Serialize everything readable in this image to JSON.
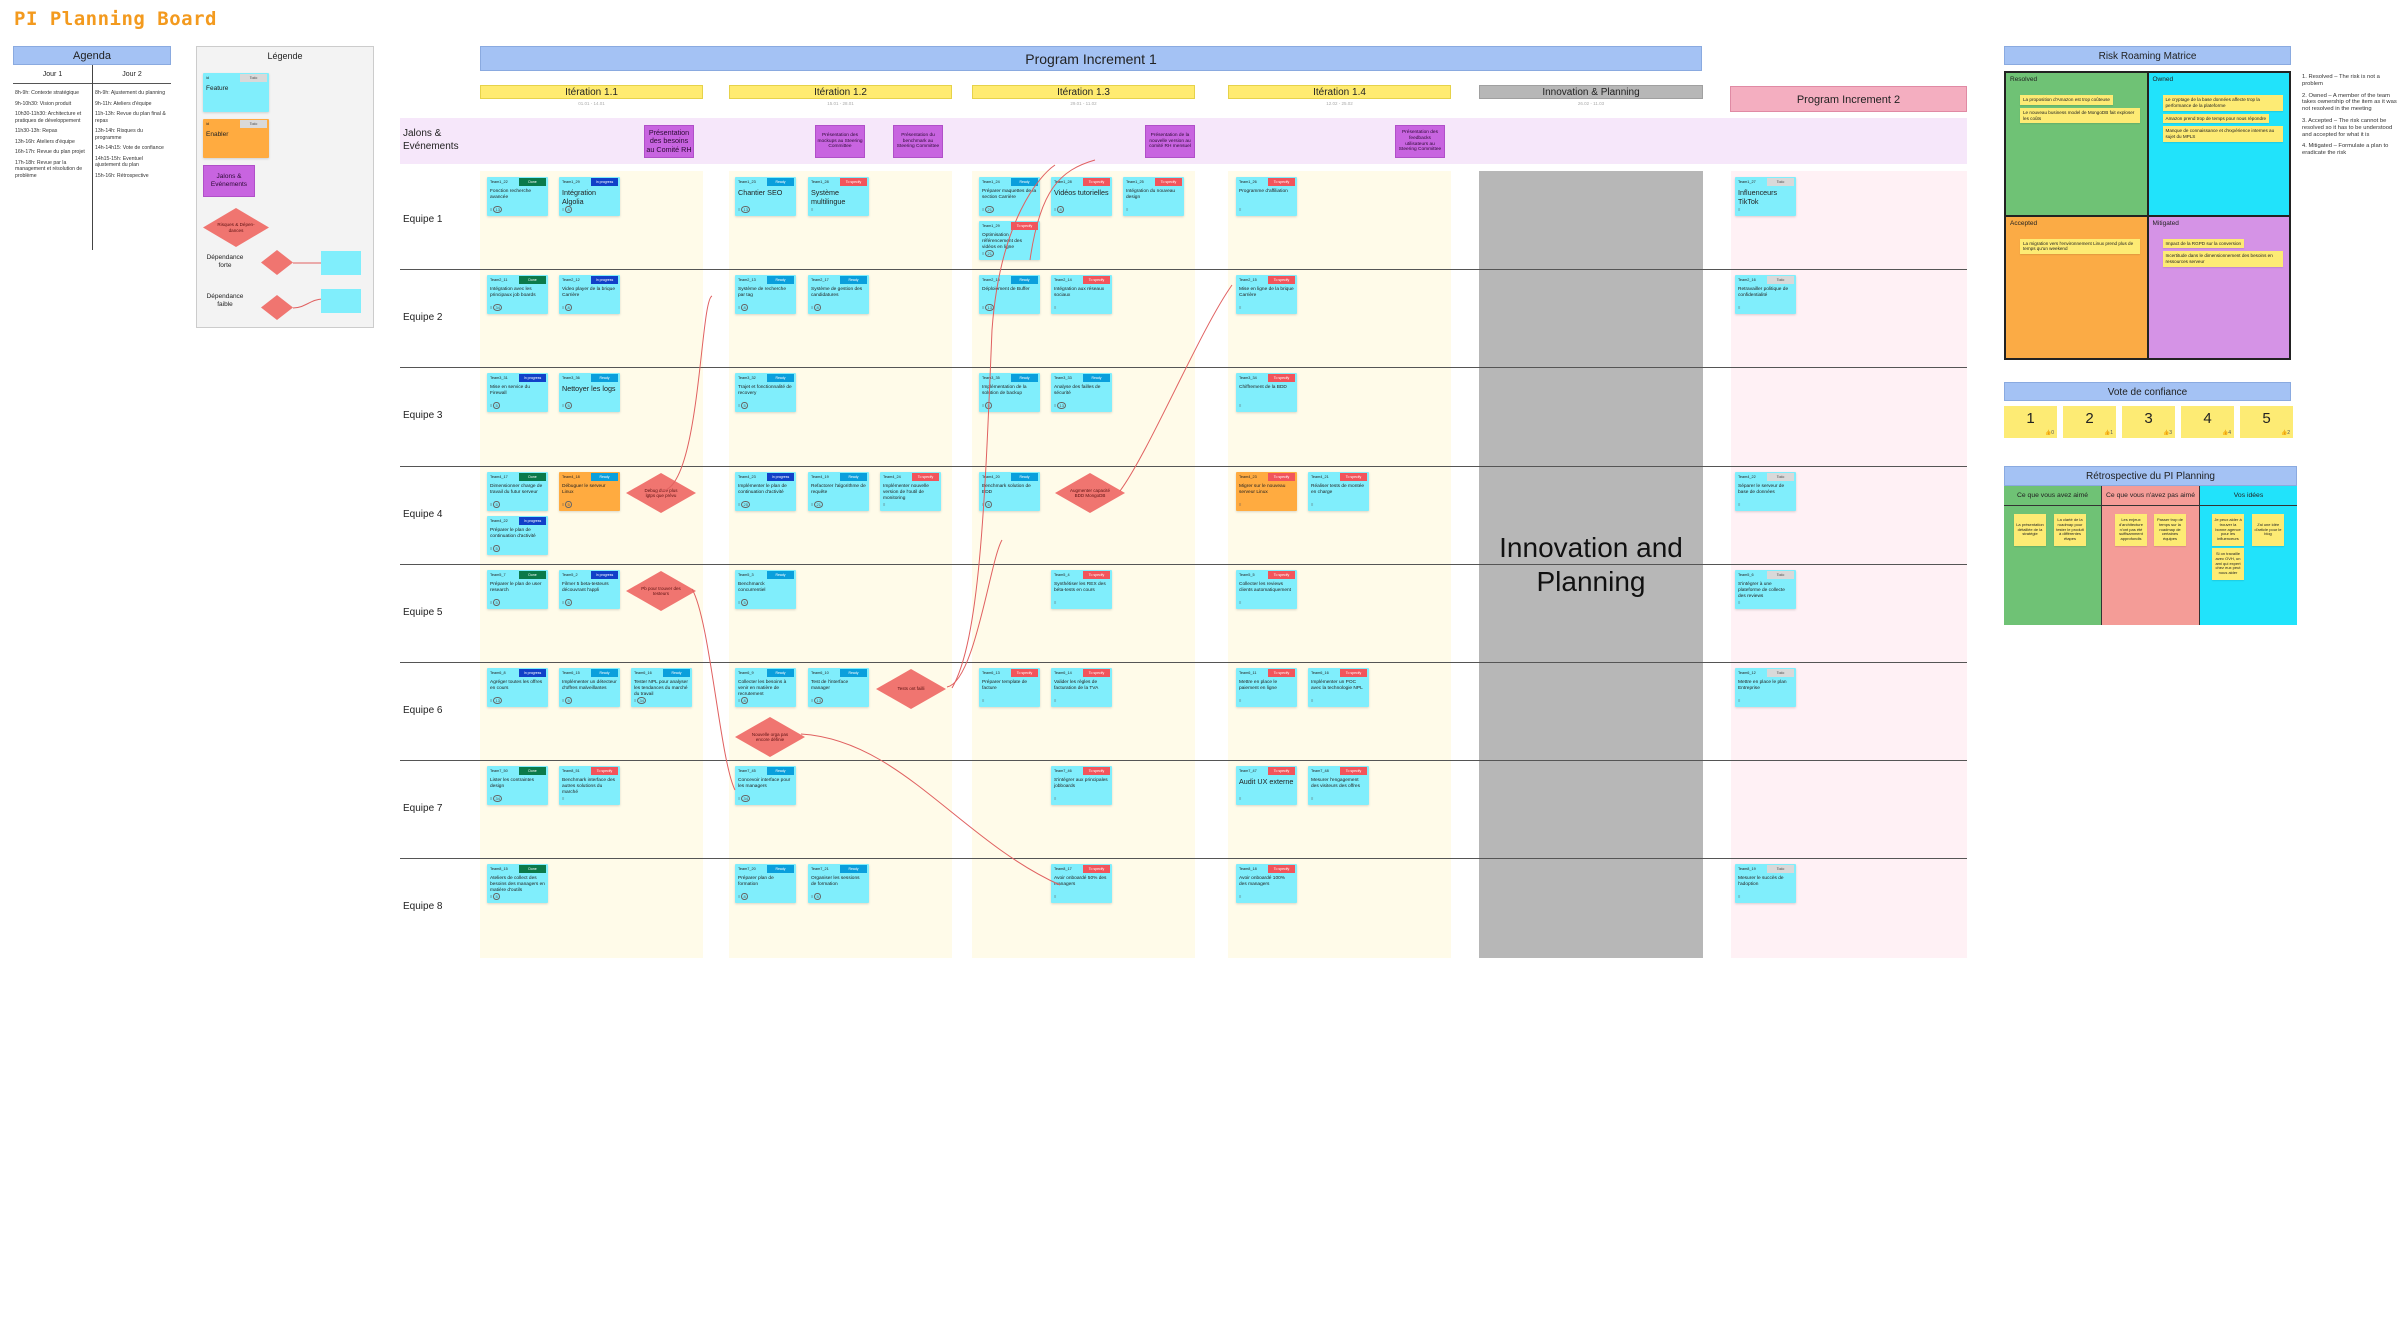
{
  "title": "PI Planning Board",
  "agenda": {
    "title": "Agenda",
    "days": [
      {
        "label": "Jour 1",
        "items": [
          "8h-9h: Contexte stratégique",
          "9h-10h30: Vision produit",
          "10h30-11h30: Architecture et pratiques de développement",
          "11h30-13h: Repas",
          "13h-16h: Ateliers d'équipe",
          "16h-17h: Revue du plan projet",
          "17h-18h: Revue par la management et résolution de problème"
        ]
      },
      {
        "label": "Jour 2",
        "items": [
          "8h-9h: Ajustement du planning",
          "9h-11h: Ateliers d'équipe",
          "11h-13h: Revue du plan final & repas",
          "13h-14h: Risques du programme",
          "14h-14h15: Vote de confiance",
          "14h15-15h: Eventuel ajustement du plan",
          "15h-16h: Rétrospective"
        ]
      }
    ]
  },
  "legend": {
    "title": "Légende",
    "feature": {
      "id": "id",
      "status": "Todo",
      "label": "Feature"
    },
    "enabler": {
      "id": "id",
      "status": "Todo",
      "label": "Enabler"
    },
    "milestone": "Jalons & Evénements",
    "risk": "Risques & Dépen-dances",
    "strong_dep": "Dépendance forte",
    "weak_dep": "Dépendance faible"
  },
  "board": {
    "pi1": "Program Increment 1",
    "pi2": "Program Increment 2",
    "iterations": [
      {
        "label": "Itération 1.1",
        "dates": "01.01 - 14.01"
      },
      {
        "label": "Itération 1.2",
        "dates": "15.01 - 28.01"
      },
      {
        "label": "Itération 1.3",
        "dates": "29.01 - 11.02"
      },
      {
        "label": "Itération 1.4",
        "dates": "12.02 - 25.02"
      },
      {
        "label": "Innovation & Planning",
        "dates": "26.02 - 11.03"
      }
    ],
    "innovation_block": "Innovation and Planning",
    "jalons_label": "Jalons & Evénements",
    "milestones": [
      "Présentation des besoins au Comité RH",
      "Présentation des mockups au Steering Committee",
      "Présentation du benchmark au Steering Committee",
      "Présentation de la nouvelle version au comité RH mensuel",
      "Présentation des feedbacks utilisateurs au Steering Committee"
    ],
    "lanes": [
      "Equipe 1",
      "Equipe 2",
      "Equipe 3",
      "Equipe 4",
      "Equipe 5",
      "Equipe 6",
      "Equipe 7",
      "Equipe 8"
    ],
    "cards": [
      {
        "id": "Team1_22",
        "status": "Done",
        "title": "Fonction recherche avancée",
        "points": "13"
      },
      {
        "id": "Team1_29",
        "status": "In progress",
        "title": "Intégration Algolia",
        "points": "8"
      },
      {
        "id": "Team1_23",
        "status": "Ready",
        "title": "Chantier SEO",
        "points": "13"
      },
      {
        "id": "Team1_28",
        "status": "To specify",
        "title": "Système multilingue",
        "points": ""
      },
      {
        "id": "Team1_24",
        "status": "Ready",
        "title": "Préparer maquettes de la section Carrière",
        "points": "21"
      },
      {
        "id": "Team1_28",
        "status": "To specify",
        "title": "Vidéos tutorielles",
        "points": "8"
      },
      {
        "id": "Team1_25",
        "status": "To specify",
        "title": "Intégration du nouveau design",
        "points": ""
      },
      {
        "id": "Team1_29",
        "status": "To specify",
        "title": "Optimisation référencement des vidéos en ligne",
        "points": "21"
      },
      {
        "id": "Team1_26",
        "status": "To specify",
        "title": "Programme d'affiliation",
        "points": ""
      },
      {
        "id": "Team1_27",
        "status": "Todo",
        "title": "Influenceurs TikTok",
        "points": ""
      },
      {
        "id": "Team2_11",
        "status": "Done",
        "title": "Intégration avec les principaux job boards",
        "points": "34"
      },
      {
        "id": "Team2_12",
        "status": "In progress",
        "title": "Video player de la brique Carrière",
        "points": "8"
      },
      {
        "id": "Team2_13",
        "status": "Ready",
        "title": "Système de recherche par tag",
        "points": "8"
      },
      {
        "id": "Team2_17",
        "status": "Ready",
        "title": "Système de gestion des candidatures",
        "points": "8"
      },
      {
        "id": "Team2_15",
        "status": "Ready",
        "title": "Déploiement de Buffer",
        "points": "13"
      },
      {
        "id": "Team2_14",
        "status": "To specify",
        "title": "Intégration aux réseaux sociaux",
        "points": ""
      },
      {
        "id": "Team2_15",
        "status": "To specify",
        "title": "Mise en ligne de la brique Carrière",
        "points": ""
      },
      {
        "id": "Team2_16",
        "status": "Todo",
        "title": "Retravailler politique de confidentialité",
        "points": ""
      },
      {
        "id": "Team3_31",
        "status": "In progress",
        "title": "Mise en service du Firewall",
        "points": "5"
      },
      {
        "id": "Team3_36",
        "status": "Ready",
        "title": "Nettoyer les logs",
        "points": "5"
      },
      {
        "id": "Team3_32",
        "status": "Ready",
        "title": "Trajet et fonctionnalité de recovery",
        "points": "5"
      },
      {
        "id": "Team3_35",
        "status": "Ready",
        "title": "Implémentation de la solution de backup",
        "points": "5"
      },
      {
        "id": "Team3_33",
        "status": "Ready",
        "title": "Analyse des failles de sécurité",
        "points": "13"
      },
      {
        "id": "Team3_34",
        "status": "To specify",
        "title": "Chiffrement de la BDD",
        "points": ""
      },
      {
        "id": "Team4_17",
        "status": "Done",
        "title": "Dimensionner charge de travail du futur serveur",
        "points": "5"
      },
      {
        "id": "Team4_18",
        "status": "Ready",
        "title": "Débuguer le serveur Linux",
        "points": "5",
        "type": "enabler"
      },
      {
        "id": "Team4_22",
        "status": "In progress",
        "title": "Préparer le plan de continuation d'activité",
        "points": "5"
      },
      {
        "id": "Team4_23",
        "status": "In progress",
        "title": "Implémenter le plan de continuation d'activité",
        "points": "25"
      },
      {
        "id": "Team4_19",
        "status": "Ready",
        "title": "Refactorer l'algorithme de requête",
        "points": "21"
      },
      {
        "id": "Team4_24",
        "status": "To specify",
        "title": "Implémenter nouvelle version de l'outil de monitoring",
        "points": ""
      },
      {
        "id": "Team4_20",
        "status": "Ready",
        "title": "Benchmark solution de BDD",
        "points": "5"
      },
      {
        "id": "Team4_23",
        "status": "To specify",
        "title": "Migrer sur le nouveau serveur Linux",
        "points": "",
        "type": "enabler"
      },
      {
        "id": "Team4_21",
        "status": "To specify",
        "title": "Réaliser tests de montée en charge",
        "points": ""
      },
      {
        "id": "Team4_22",
        "status": "Todo",
        "title": "Séparer le serveur de base de données",
        "points": ""
      },
      {
        "id": "Team5_7",
        "status": "Done",
        "title": "Préparer le plan de user research",
        "points": "5"
      },
      {
        "id": "Team5_2",
        "status": "In progress",
        "title": "Filmer 5 beta-testeurs découvrant l'appli",
        "points": "5"
      },
      {
        "id": "Team5_3",
        "status": "Ready",
        "title": "Benchmarck concurrentiel",
        "points": "5"
      },
      {
        "id": "Team5_4",
        "status": "To specify",
        "title": "Synthétiser les REX des béta-tests en cours",
        "points": ""
      },
      {
        "id": "Team5_5",
        "status": "To specify",
        "title": "Collecter les reviews clients automatiquement",
        "points": ""
      },
      {
        "id": "Team5_6",
        "status": "Todo",
        "title": "S'intégrer à une plateforme de collecte des reviews",
        "points": ""
      },
      {
        "id": "Team6_8",
        "status": "In progress",
        "title": "Agréger toutes les offres en cours",
        "points": "13"
      },
      {
        "id": "Team6_15",
        "status": "Ready",
        "title": "Implémenter un détecteur d'offres malveillantes",
        "points": "5"
      },
      {
        "id": "Team6_16",
        "status": "Ready",
        "title": "Tester NPL pour analyser les tendances du marché du travail",
        "points": "34"
      },
      {
        "id": "Team6_9",
        "status": "Ready",
        "title": "Collecter les besoins à venir en matière de recrutement",
        "points": "8"
      },
      {
        "id": "Team6_10",
        "status": "Ready",
        "title": "Test de l'interface manager",
        "points": "13"
      },
      {
        "id": "Team6_13",
        "status": "To specify",
        "title": "Préparer template de facture",
        "points": ""
      },
      {
        "id": "Team6_14",
        "status": "To specify",
        "title": "Valider les règles de facturation de la TVA",
        "points": ""
      },
      {
        "id": "Team6_11",
        "status": "To specify",
        "title": "Mettre en place le paiement en ligne",
        "points": ""
      },
      {
        "id": "Team6_16",
        "status": "To specify",
        "title": "Implémenter un POC avec la technologie NPL",
        "points": ""
      },
      {
        "id": "Team6_12",
        "status": "Todo",
        "title": "Mettre en place le plan Entreprise",
        "points": ""
      },
      {
        "id": "Team7_50",
        "status": "Done",
        "title": "Lister les contraintes design",
        "points": "34"
      },
      {
        "id": "Team8_51",
        "status": "To specify",
        "title": "Benchmark interface des autres solutions du marché",
        "points": ""
      },
      {
        "id": "Team7_45",
        "status": "Ready",
        "title": "Concevoir interface pour les managers",
        "points": "34"
      },
      {
        "id": "Team7_46",
        "status": "To specify",
        "title": "S'intégrer aux principales jobboards",
        "points": ""
      },
      {
        "id": "Team7_47",
        "status": "To specify",
        "title": "Audit UX externe",
        "points": ""
      },
      {
        "id": "Team7_48",
        "status": "To specify",
        "title": "Mesurer l'engagement des visiteurs des offres",
        "points": ""
      },
      {
        "id": "Team8_15",
        "status": "Done",
        "title": "Ateliers de collect des besoins des managers en matière d'outils",
        "points": "5"
      },
      {
        "id": "Team7_20",
        "status": "Ready",
        "title": "Préparer plan de formation",
        "points": "8"
      },
      {
        "id": "Team7_21",
        "status": "Ready",
        "title": "Organiser les sessions de formation",
        "points": "5"
      },
      {
        "id": "Team8_17",
        "status": "To specify",
        "title": "Avoir onboardé 50% des managers",
        "points": ""
      },
      {
        "id": "Team8_18",
        "status": "To specify",
        "title": "Avoir onboardé 100% des managers",
        "points": ""
      },
      {
        "id": "Team8_19",
        "status": "Todo",
        "title": "Mesurer le succès de l'adoption",
        "points": ""
      }
    ],
    "risks": [
      "Debug dure plus lgtps que prévu",
      "Augmenter capacité BDD MongoDB",
      "Pb pour trouver des testeurs",
      "Tests ont failli",
      "Nouvelle orga pas encore définie"
    ]
  },
  "risk_matrix": {
    "title": "Risk Roaming Matrice",
    "quadrants": [
      {
        "label": "Resolved",
        "notes": [
          "La proposition d'Amazon est trop coûteuse",
          "Le nouveau business model de MongoDB fait exploser les coûts"
        ]
      },
      {
        "label": "Owned",
        "notes": [
          "Le cryptage de la base données affecte trop la performance de la plateforme",
          "Amazon prend trop de temps pour nous répondre",
          "Manque de connaissance et d'expérience internes au sujet du MPLS"
        ]
      },
      {
        "label": "Accepted",
        "notes": [
          "La migration vers l'environnement Linux prend plus de temps qu'un weekend"
        ]
      },
      {
        "label": "Mitigated",
        "notes": [
          "Impact de la RGPD sur la conversion",
          "Incertitude dans le dimensionnement des besoins en ressources serveur"
        ]
      }
    ],
    "definitions": [
      "1. Resolved – The risk is not a problem",
      "2. Owned – A member of the team takes ownership of the item as it was not resolved in the meeting",
      "3. Accepted – The risk cannot be resolved so it has to be understood and accepted for what it is",
      "4. Mitigated – Formulate a plan to eradicate the risk"
    ]
  },
  "vote": {
    "title": "Vote de confiance",
    "options": [
      {
        "label": "1",
        "count": "0"
      },
      {
        "label": "2",
        "count": "1"
      },
      {
        "label": "3",
        "count": "3"
      },
      {
        "label": "4",
        "count": "4"
      },
      {
        "label": "5",
        "count": "2"
      }
    ]
  },
  "retro": {
    "title": "Rétrospective du PI Planning",
    "columns": [
      {
        "label": "Ce que vous avez aimé",
        "notes": [
          "La présentation détaillée de la stratégie",
          "La clarté de la roadmap pour tester le produit à différentes étapes"
        ]
      },
      {
        "label": "Ce que vous n'avez pas aimé",
        "notes": [
          "Les enjeux d'architecture n'ont pas été suffisamment approfondis",
          "Passer trop de temps sur la roadmap de certaines équipes"
        ]
      },
      {
        "label": "Vos idées",
        "notes": [
          "Je peux aider à trouver la bonne agence pour les influenceurs",
          "J'ai une idée d'article pour le blog",
          "Si on travaille avec OVH, un ami qui expert chez eux peut nous aider"
        ]
      }
    ]
  }
}
